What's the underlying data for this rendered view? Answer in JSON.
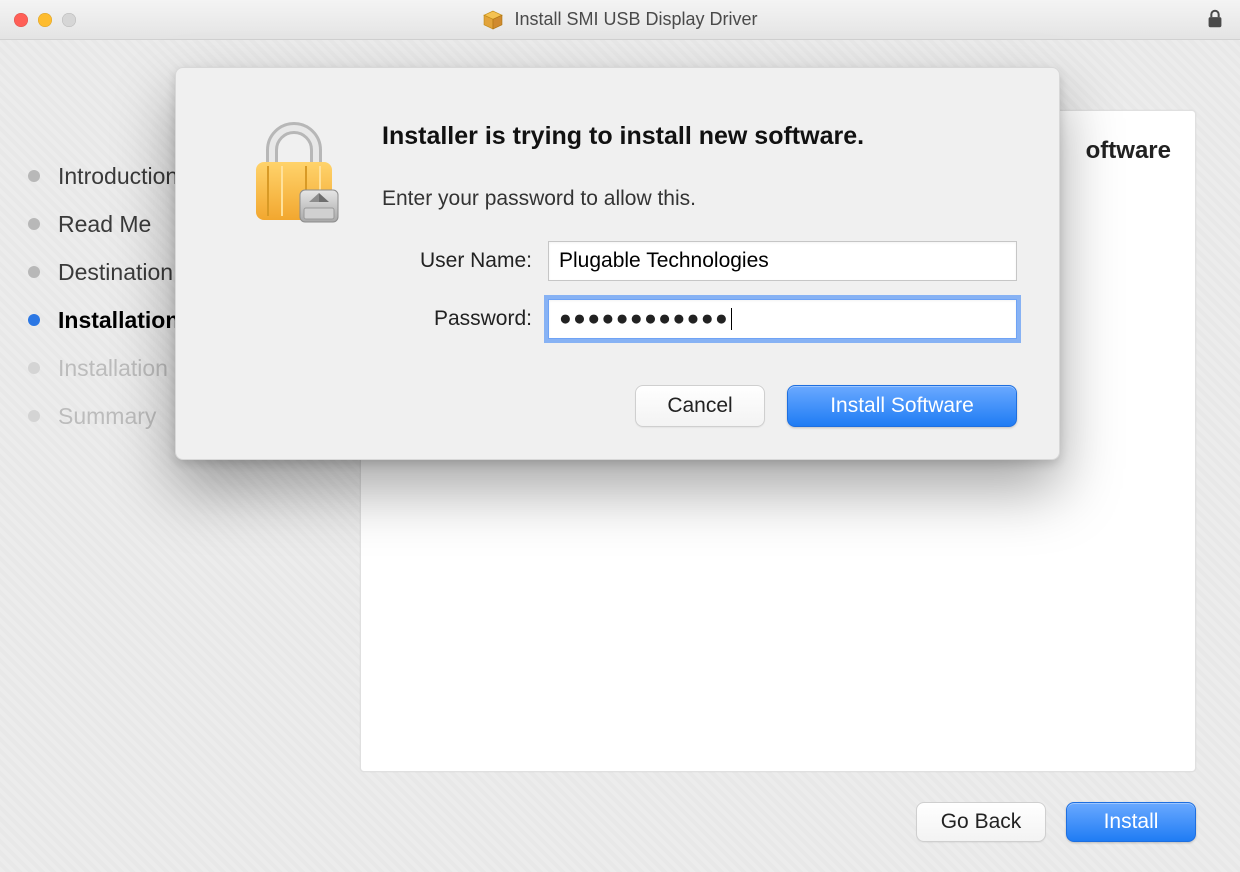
{
  "window": {
    "title": "Install SMI USB Display Driver"
  },
  "steps": {
    "items": [
      {
        "label": "Introduction",
        "state": "done"
      },
      {
        "label": "Read Me",
        "state": "done"
      },
      {
        "label": "Destination Select",
        "state": "done"
      },
      {
        "label": "Installation Type",
        "state": "active"
      },
      {
        "label": "Installation",
        "state": "future"
      },
      {
        "label": "Summary",
        "state": "future"
      }
    ]
  },
  "main_panel": {
    "heading_suffix": "oftware",
    "line_prefix": ""
  },
  "footer": {
    "back_label": "Go Back",
    "install_label": "Install"
  },
  "auth_sheet": {
    "heading": "Installer is trying to install new software.",
    "subtext": "Enter your password to allow this.",
    "username_label": "User Name:",
    "username_value": "Plugable Technologies",
    "password_label": "Password:",
    "password_mask": "●●●●●●●●●●●●",
    "cancel_label": "Cancel",
    "confirm_label": "Install Software"
  }
}
